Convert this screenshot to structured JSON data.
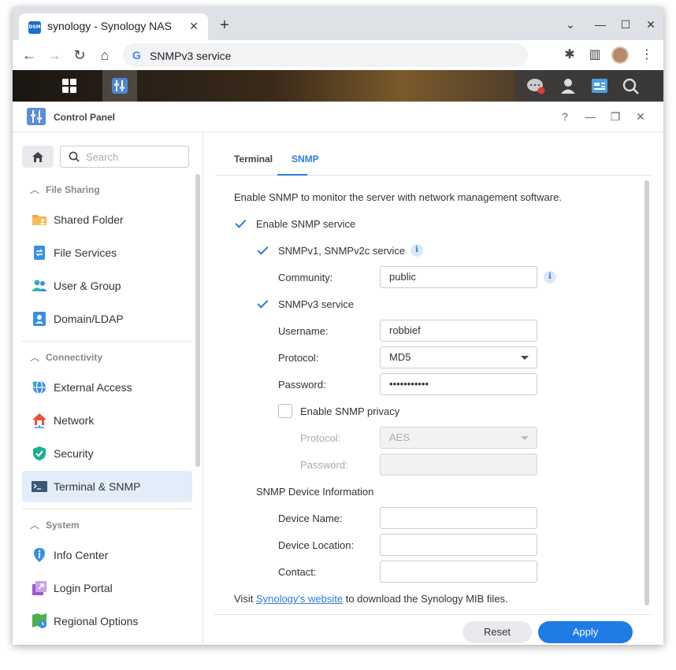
{
  "browser": {
    "tab_title": "synology - Synology NAS",
    "favicon_text": "DSM",
    "url_text": "SNMPv3 service",
    "icons": [
      "dropdown-icon",
      "minimize-icon",
      "maximize-icon",
      "close-icon",
      "back-icon",
      "forward-icon",
      "reload-icon",
      "home-icon",
      "extensions-icon",
      "sidebar-icon",
      "menu-icon"
    ]
  },
  "dsm_taskbar": {
    "icons": [
      "app-grid-icon",
      "control-panel-icon",
      "notification-icon",
      "user-icon",
      "widgets-icon",
      "search-icon"
    ],
    "notification_color": "#e53935"
  },
  "control_panel": {
    "title": "Control Panel",
    "window_controls": [
      "help-icon",
      "minimize-icon",
      "restore-icon",
      "close-icon"
    ]
  },
  "sidebar": {
    "search_placeholder": "Search",
    "groups": [
      {
        "label": "File Sharing",
        "items": [
          {
            "label": "Shared Folder",
            "icon": "shared-folder-icon"
          },
          {
            "label": "File Services",
            "icon": "file-services-icon"
          },
          {
            "label": "User & Group",
            "icon": "user-group-icon"
          },
          {
            "label": "Domain/LDAP",
            "icon": "domain-ldap-icon"
          }
        ]
      },
      {
        "label": "Connectivity",
        "items": [
          {
            "label": "External Access",
            "icon": "external-access-icon"
          },
          {
            "label": "Network",
            "icon": "network-icon"
          },
          {
            "label": "Security",
            "icon": "security-icon"
          },
          {
            "label": "Terminal & SNMP",
            "icon": "terminal-icon",
            "active": true
          }
        ]
      },
      {
        "label": "System",
        "items": [
          {
            "label": "Info Center",
            "icon": "info-center-icon"
          },
          {
            "label": "Login Portal",
            "icon": "login-portal-icon"
          },
          {
            "label": "Regional Options",
            "icon": "regional-options-icon"
          }
        ]
      }
    ]
  },
  "main": {
    "tabs": [
      {
        "label": "Terminal"
      },
      {
        "label": "SNMP",
        "active": true
      }
    ],
    "description": "Enable SNMP to monitor the server with network management software.",
    "enable_snmp": {
      "label": "Enable SNMP service",
      "checked": true
    },
    "snmpv1": {
      "label": "SNMPv1, SNMPv2c service",
      "checked": true
    },
    "community": {
      "label": "Community:",
      "value": "public"
    },
    "snmpv3": {
      "label": "SNMPv3 service",
      "checked": true
    },
    "username": {
      "label": "Username:",
      "value": "robbief"
    },
    "protocol": {
      "label": "Protocol:",
      "value": "MD5"
    },
    "password": {
      "label": "Password:",
      "value": "•••••••••••"
    },
    "privacy": {
      "label": "Enable SNMP privacy",
      "checked": false
    },
    "privacy_protocol": {
      "label": "Protocol:",
      "value": "AES"
    },
    "privacy_password": {
      "label": "Password:",
      "value": ""
    },
    "device_info_title": "SNMP Device Information",
    "device_name": {
      "label": "Device Name:",
      "value": ""
    },
    "device_location": {
      "label": "Device Location:",
      "value": ""
    },
    "contact": {
      "label": "Contact:",
      "value": ""
    },
    "footer": {
      "prefix": "Visit ",
      "link": "Synology's website",
      "suffix": " to download the Synology MIB files."
    },
    "reset_label": "Reset",
    "apply_label": "Apply",
    "accent_color": "#2c7cd6"
  }
}
